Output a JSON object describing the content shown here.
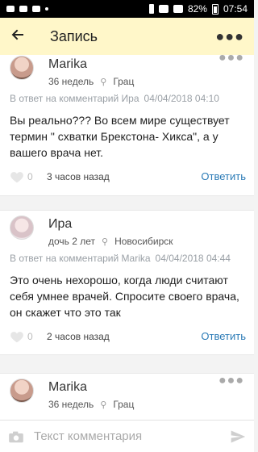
{
  "status": {
    "battery": "82%",
    "time": "07:54"
  },
  "header": {
    "title": "Запись",
    "back_icon": "arrow-back-icon",
    "more_icon": "more-horizontal-icon"
  },
  "comments": [
    {
      "name": "Marika",
      "age": "36 недель",
      "location": "Грац",
      "reply_to_label": "В ответ на комментарий Ира",
      "reply_to_date": "04/04/2018 04:10",
      "text": "Вы реально??? Во всем мире существует термин \" схватки Брекстона- Хикса\", а у вашего врача нет.",
      "likes": "0",
      "time": "3 часов назад",
      "reply_label": "Ответить"
    },
    {
      "name": "Ира",
      "age": "дочь 2 лет",
      "location": "Новосибирск",
      "reply_to_label": "В ответ на комментарий Marika",
      "reply_to_date": "04/04/2018 04:44",
      "text": "Это очень нехорошо, когда люди считают себя умнее врачей. Спросите своего врача, он скажет что это так",
      "likes": "0",
      "time": "2 часов назад",
      "reply_label": "Ответить"
    },
    {
      "name": "Marika",
      "age": "36 недель",
      "location": "Грац"
    }
  ],
  "input": {
    "placeholder": "Текст комментария"
  }
}
